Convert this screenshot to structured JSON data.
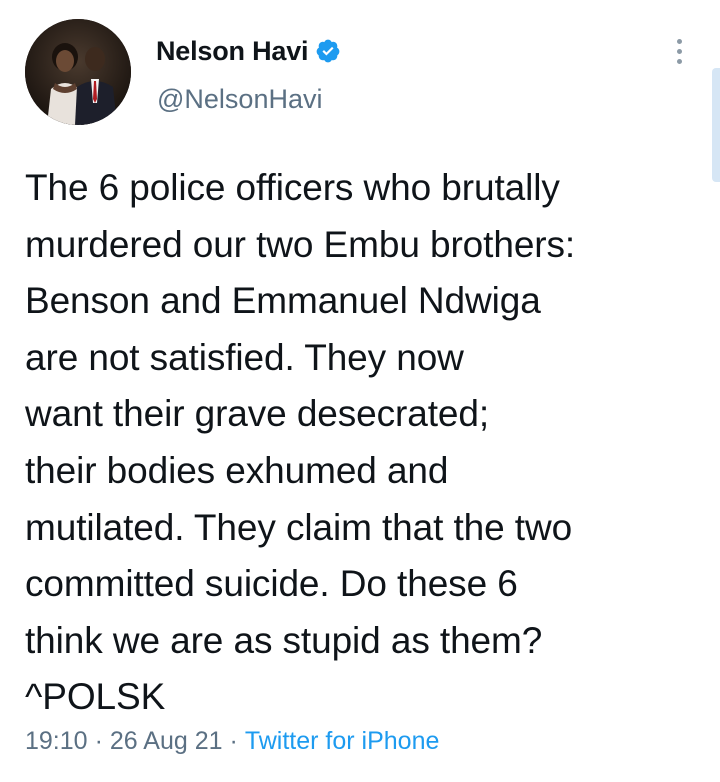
{
  "tweet": {
    "author": {
      "display_name": "Nelson Havi",
      "handle": "@NelsonHavi",
      "verified": true,
      "avatar_icon": "profile-photo"
    },
    "text": "The 6 police officers who brutally\nmurdered our two Embu brothers:\nBenson and Emmanuel Ndwiga\nare not satisfied. They now\nwant their grave desecrated;\ntheir bodies exhumed and\nmutilated. They claim that the two\ncommitted suicide. Do these 6\nthink we are as stupid as them?\n^POLSK",
    "time": "19:10",
    "date": "26 Aug 21",
    "separator": "·",
    "source": "Twitter for iPhone"
  },
  "colors": {
    "text_primary": "#0f1419",
    "text_secondary": "#5b7083",
    "link": "#1d9bf0",
    "verified_badge": "#1d9bf0",
    "background": "#ffffff"
  }
}
